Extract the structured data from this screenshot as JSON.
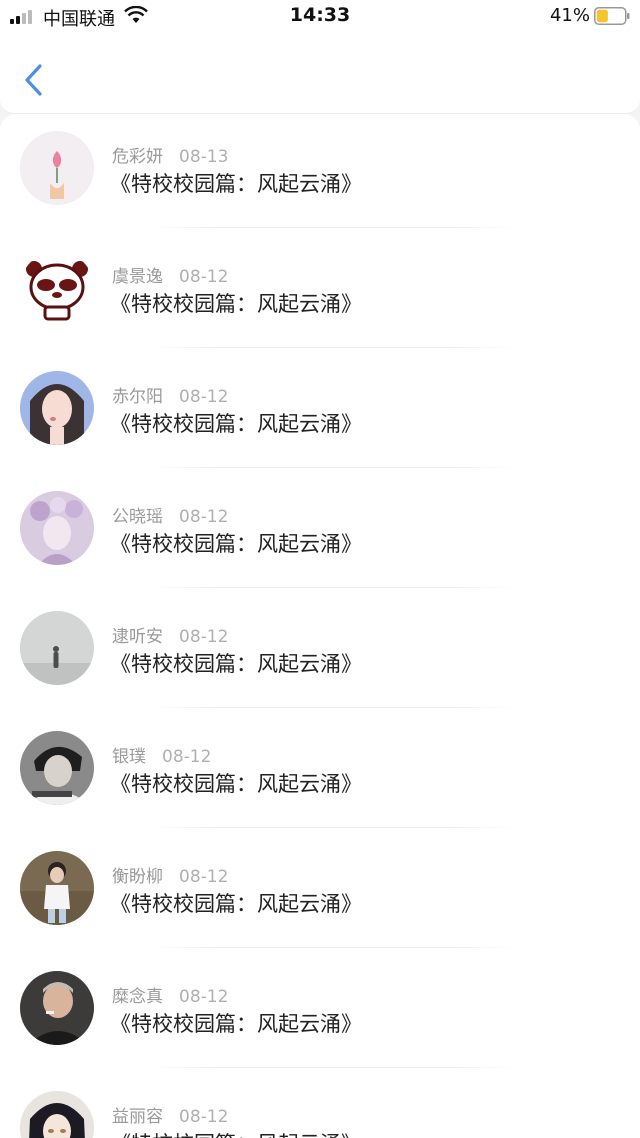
{
  "status_bar": {
    "carrier": "中国联通",
    "time": "14:33",
    "battery": "41%",
    "battery_level": 0.41,
    "battery_color": "#f5c431"
  },
  "nav": {
    "back_icon": "chevron-left-icon",
    "accent_color": "#4a90e2"
  },
  "items": [
    {
      "name": "危彩妍",
      "date": "08-13",
      "title": "《特校校园篇：风起云涌》"
    },
    {
      "name": "虞景逸",
      "date": "08-12",
      "title": "《特校校园篇：风起云涌》"
    },
    {
      "name": "赤尔阳",
      "date": "08-12",
      "title": "《特校校园篇：风起云涌》"
    },
    {
      "name": "公晓瑶",
      "date": "08-12",
      "title": "《特校校园篇：风起云涌》"
    },
    {
      "name": "逮听安",
      "date": "08-12",
      "title": "《特校校园篇：风起云涌》"
    },
    {
      "name": "银璞",
      "date": "08-12",
      "title": "《特校校园篇：风起云涌》"
    },
    {
      "name": "衡盼柳",
      "date": "08-12",
      "title": "《特校校园篇：风起云涌》"
    },
    {
      "name": "糜念真",
      "date": "08-12",
      "title": "《特校校园篇：风起云涌》"
    },
    {
      "name": "益丽容",
      "date": "08-12",
      "title": "《特校校园篇：风起云涌》"
    }
  ]
}
